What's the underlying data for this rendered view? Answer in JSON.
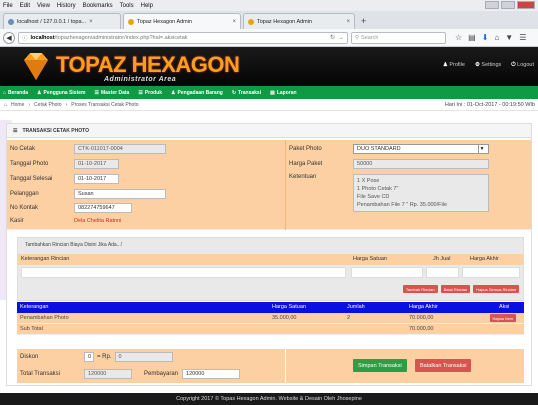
{
  "browser": {
    "menu": [
      "File",
      "Edit",
      "View",
      "History",
      "Bookmarks",
      "Tools",
      "Help"
    ],
    "tabs": [
      {
        "label": "localhost / 127.0.0.1 / topa..."
      },
      {
        "label": "Topaz Hexagon Admin"
      },
      {
        "label": "Topaz Hexagon Admin"
      }
    ],
    "url_host": "localhost",
    "url_path": "/topazhexagon/administrator/index.php?hal=.aksicetak",
    "search_placeholder": "Search"
  },
  "header": {
    "brand": "TOPAZ HEXAGON",
    "sub": "Administrator Area",
    "profile": "Profile",
    "settings": "Settings",
    "logout": "Logout"
  },
  "nav": [
    "Beranda",
    "Pengguna Sistem",
    "Master Data",
    "Produk",
    "Pengadaan Barang",
    "Transaksi",
    "Laporan"
  ],
  "crumb": {
    "home": "Home",
    "a": "Cetak Photo",
    "b": "Proses Transaksi Cetak Photo",
    "datetime": "Hari Ini : 01-Oct-2017 - 00:19:50 WIb"
  },
  "panel": {
    "title": "TRANSAKSI CETAK PHOTO"
  },
  "form": {
    "no_cetak_label": "No Cetak",
    "no_cetak": "CTK-011017-0004",
    "tgl_photo_label": "Tanggal Photo",
    "tgl_photo": "01-10-2017",
    "tgl_selesai_label": "Tanggal Selesai",
    "tgl_selesai": "01-10-2017",
    "pelanggan_label": "Pelanggan",
    "pelanggan": "Susan",
    "kontak_label": "No Kontak",
    "kontak": "082274759647",
    "kasir_label": "Kasir",
    "kasir": "Dela Chelita Ratnni",
    "paket_label": "Paket Photo",
    "paket": "DUO STANDARD",
    "harga_paket_label": "Harga Paket",
    "harga_paket": "50000",
    "ketentuan_label": "Ketentuan",
    "ketentuan": [
      "1 X Pose",
      "1 Photo Cetak 7\"",
      "File Save CD",
      "Penambahan File 7 \" Rp. 35.000/File"
    ]
  },
  "rincian": {
    "title": "Tambahkan Rincian Biaya Disini Jika Ada...!",
    "ket": "Keterangan Rincian",
    "harga": "Harga Satuan",
    "jml": "Jh Jual",
    "akhir": "Harga Akhir",
    "btn_tambah": "Tambah Rincian",
    "btn_batal": "Batal Rincian",
    "btn_hapus_semua": "Hapus Semua Rincian"
  },
  "table": {
    "headers": [
      "Keterangan",
      "Harga Satuan",
      "Jumlah",
      "Harga Akhir",
      "Aksi"
    ],
    "row": [
      "Penambahan Photo",
      "35.000,00",
      "2",
      "70.000,00"
    ],
    "hapus": "Hapus Item",
    "subtotal_label": "Sub Total",
    "subtotal": "70.000,00"
  },
  "bottom": {
    "diskon_label": "Diskon",
    "diskon": "0",
    "persen": "= Rp.",
    "diskon_rp": "0",
    "total_label": "Total Transaksi",
    "total": "120000",
    "bayar_label": "Pembayaran",
    "bayar": "120000",
    "save": "Simpan Transaksi",
    "cancel": "Batalkan Transaksi"
  },
  "footer": "Copyright 2017 © Topas Hexagon Admin. Website & Desain Oleh Jhosepine"
}
